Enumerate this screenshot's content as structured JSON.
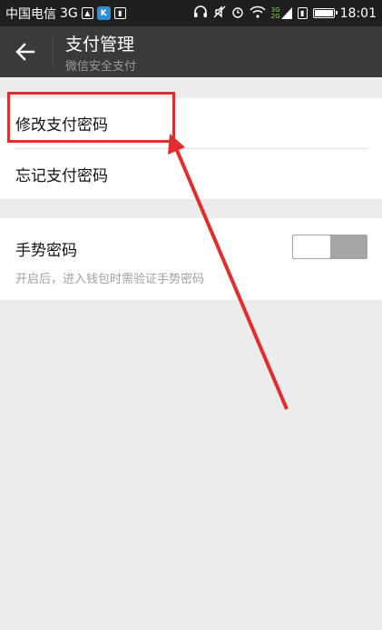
{
  "status_bar": {
    "carrier": "中国电信",
    "network": "3G",
    "time": "18:01",
    "icons": [
      "image-icon",
      "app-k-icon",
      "sim-icon",
      "headphones-icon",
      "mute-icon",
      "alarm-icon",
      "wifi-icon",
      "signal-3g-icon",
      "sim-card-icon",
      "battery-icon"
    ],
    "net_top": "3G",
    "net_bottom": "2G",
    "k_label": "K"
  },
  "header": {
    "title": "支付管理",
    "subtitle": "微信安全支付",
    "back_icon": "back-arrow-icon"
  },
  "menu": {
    "items": [
      {
        "label": "修改支付密码"
      },
      {
        "label": "忘记支付密码"
      }
    ]
  },
  "gesture": {
    "label": "手势密码",
    "description": "开启后，进入钱包时需验证手势密码",
    "enabled": false
  },
  "annotation": {
    "color": "#e52b2b"
  }
}
